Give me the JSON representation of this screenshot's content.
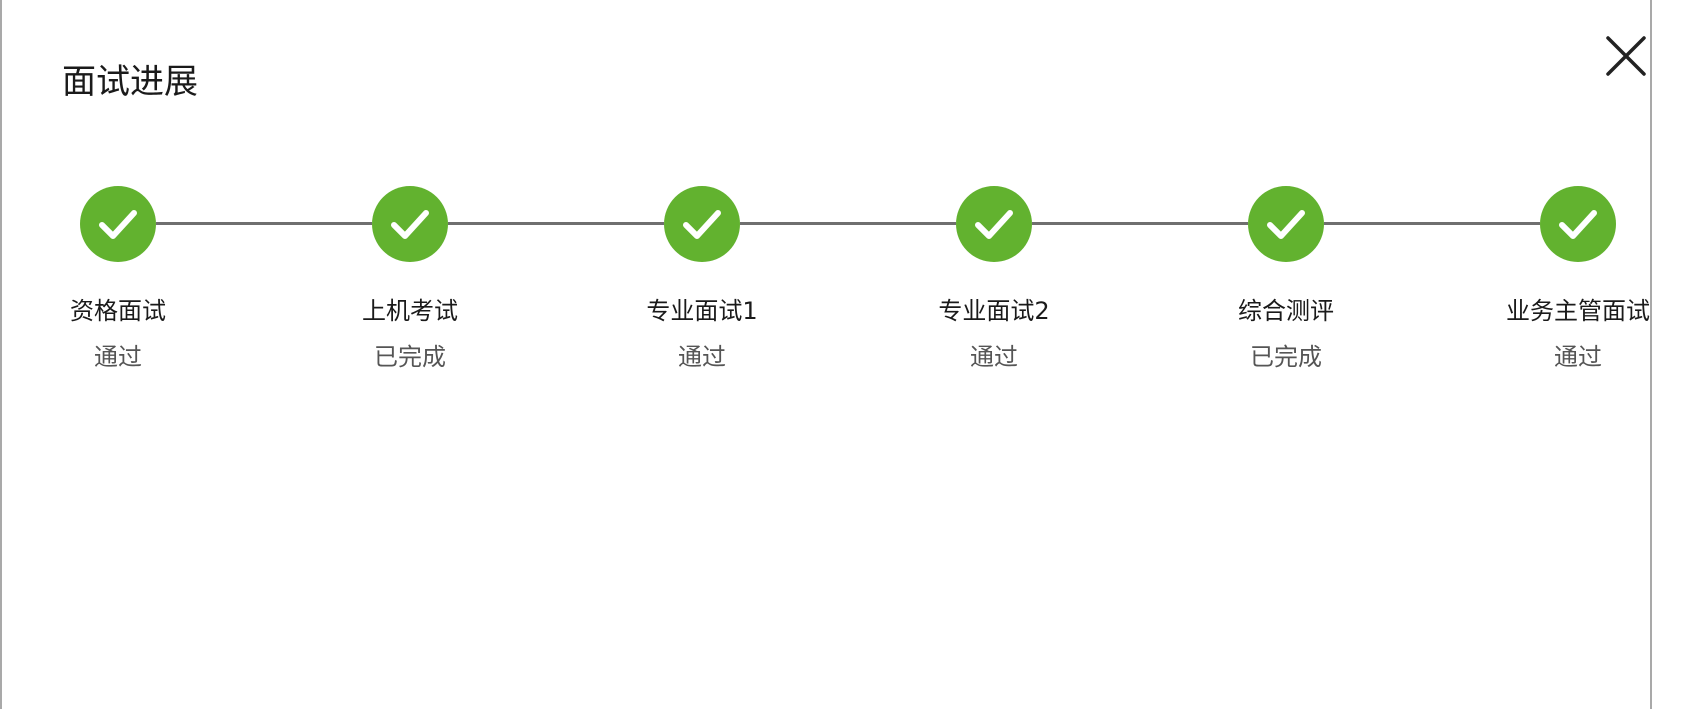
{
  "dialog": {
    "title": "面试进展",
    "close_icon": "close-icon"
  },
  "colors": {
    "step_done": "#62b22f",
    "connector": "#6f6f6f",
    "title_text": "#1a1a1a",
    "status_text": "#555555"
  },
  "steps": [
    {
      "name": "资格面试",
      "status": "通过",
      "icon": "check-icon"
    },
    {
      "name": "上机考试",
      "status": "已完成",
      "icon": "check-icon"
    },
    {
      "name": "专业面试1",
      "status": "通过",
      "icon": "check-icon"
    },
    {
      "name": "专业面试2",
      "status": "通过",
      "icon": "check-icon"
    },
    {
      "name": "综合测评",
      "status": "已完成",
      "icon": "check-icon"
    },
    {
      "name": "业务主管面试",
      "status": "通过",
      "icon": "check-icon"
    }
  ]
}
